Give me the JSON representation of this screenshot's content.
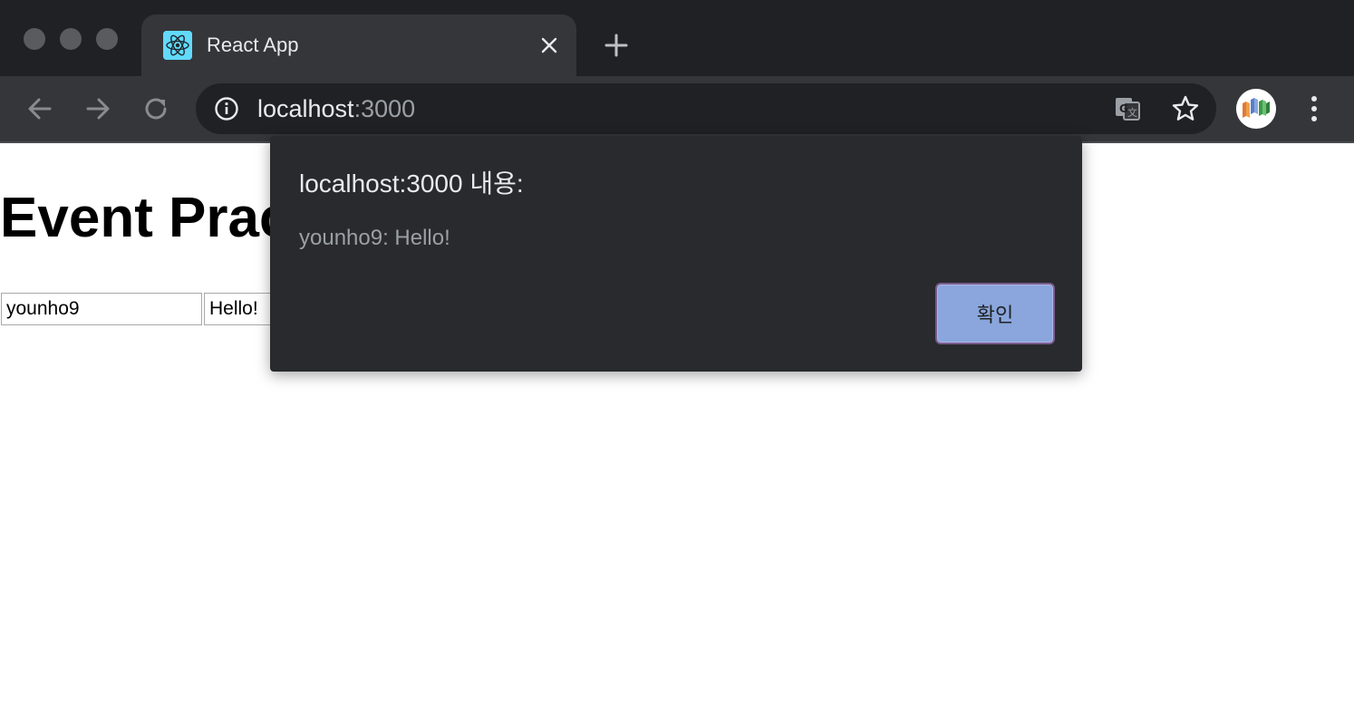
{
  "browser": {
    "tab": {
      "title": "React App",
      "favicon": "react-logo-icon"
    },
    "address_bar": {
      "host": "localhost",
      "port": ":3000",
      "security_icon": "info-icon"
    },
    "icons": {
      "back": "arrow-left-icon",
      "forward": "arrow-right-icon",
      "reload": "reload-icon",
      "translate": "translate-icon",
      "bookmark": "star-icon",
      "menu": "vertical-dots-icon",
      "new_tab": "plus-icon",
      "close_tab": "close-icon"
    }
  },
  "page": {
    "heading": "Event Practice",
    "inputs": {
      "username_value": "younho9",
      "message_value": "Hello!"
    }
  },
  "dialog": {
    "title": "localhost:3000 내용:",
    "message": "younho9: Hello!",
    "ok_label": "확인"
  },
  "colors": {
    "chrome_dark": "#202124",
    "chrome_toolbar": "#35363a",
    "dialog_bg": "#292a2d",
    "ok_button": "#8aa6dc"
  }
}
